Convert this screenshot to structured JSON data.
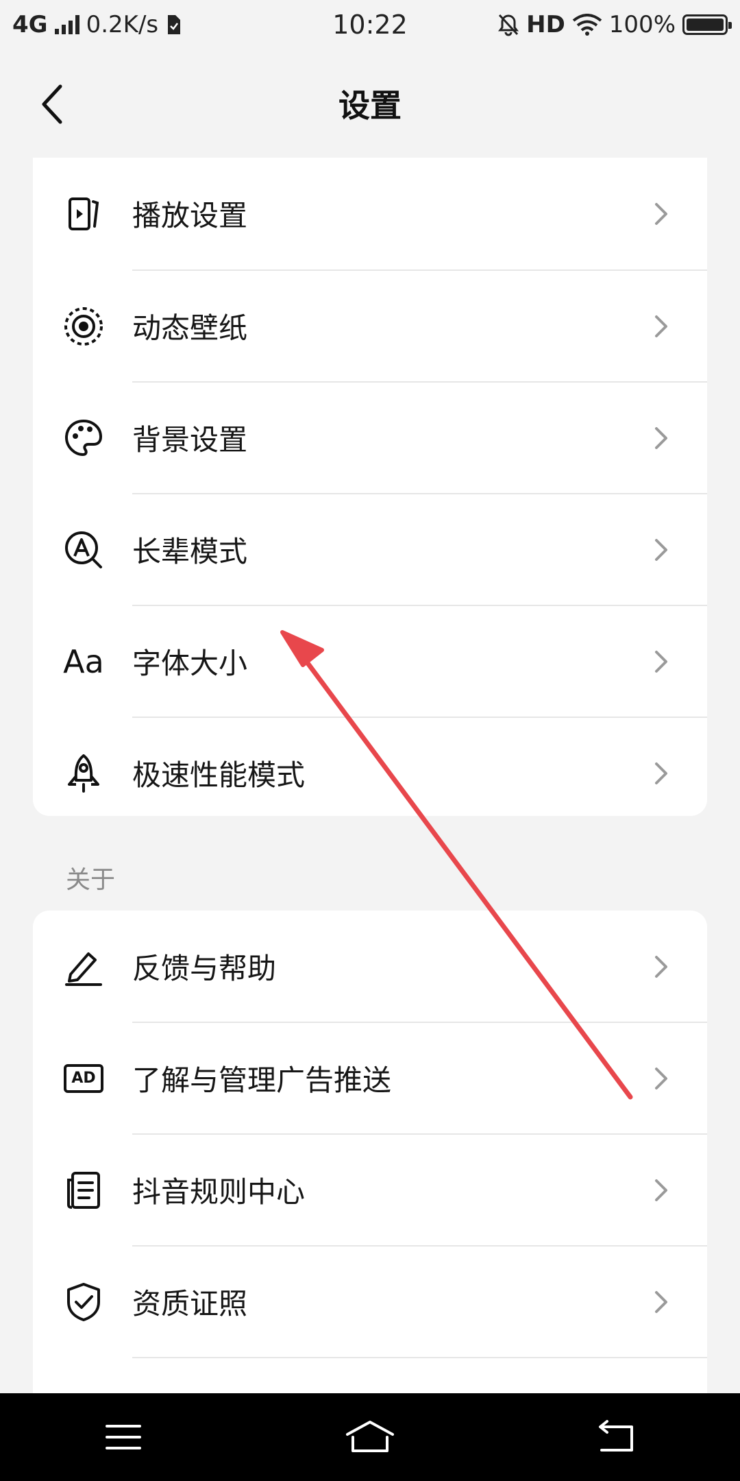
{
  "status_bar": {
    "network": "4G",
    "speed": "0.2K/s",
    "time": "10:22",
    "hd": "HD",
    "battery": "100%"
  },
  "header": {
    "title": "设置"
  },
  "top_section": {
    "items": [
      {
        "label": "播放设置",
        "icon": "play-settings-icon"
      },
      {
        "label": "动态壁纸",
        "icon": "live-wallpaper-icon"
      },
      {
        "label": "背景设置",
        "icon": "palette-icon"
      },
      {
        "label": "长辈模式",
        "icon": "elder-mode-icon"
      },
      {
        "label": "字体大小",
        "icon": "font-size-icon",
        "glyph": "Aa"
      },
      {
        "label": "极速性能模式",
        "icon": "rocket-icon"
      }
    ]
  },
  "about_section": {
    "title": "关于",
    "items": [
      {
        "label": "反馈与帮助",
        "icon": "pen-icon"
      },
      {
        "label": "了解与管理广告推送",
        "icon": "ad-icon",
        "glyph": "AD"
      },
      {
        "label": "抖音规则中心",
        "icon": "document-icon"
      },
      {
        "label": "资质证照",
        "icon": "shield-check-icon"
      }
    ]
  },
  "colors": {
    "background": "#f3f3f3",
    "card": "#ffffff",
    "annotation_arrow": "#e8474c"
  }
}
